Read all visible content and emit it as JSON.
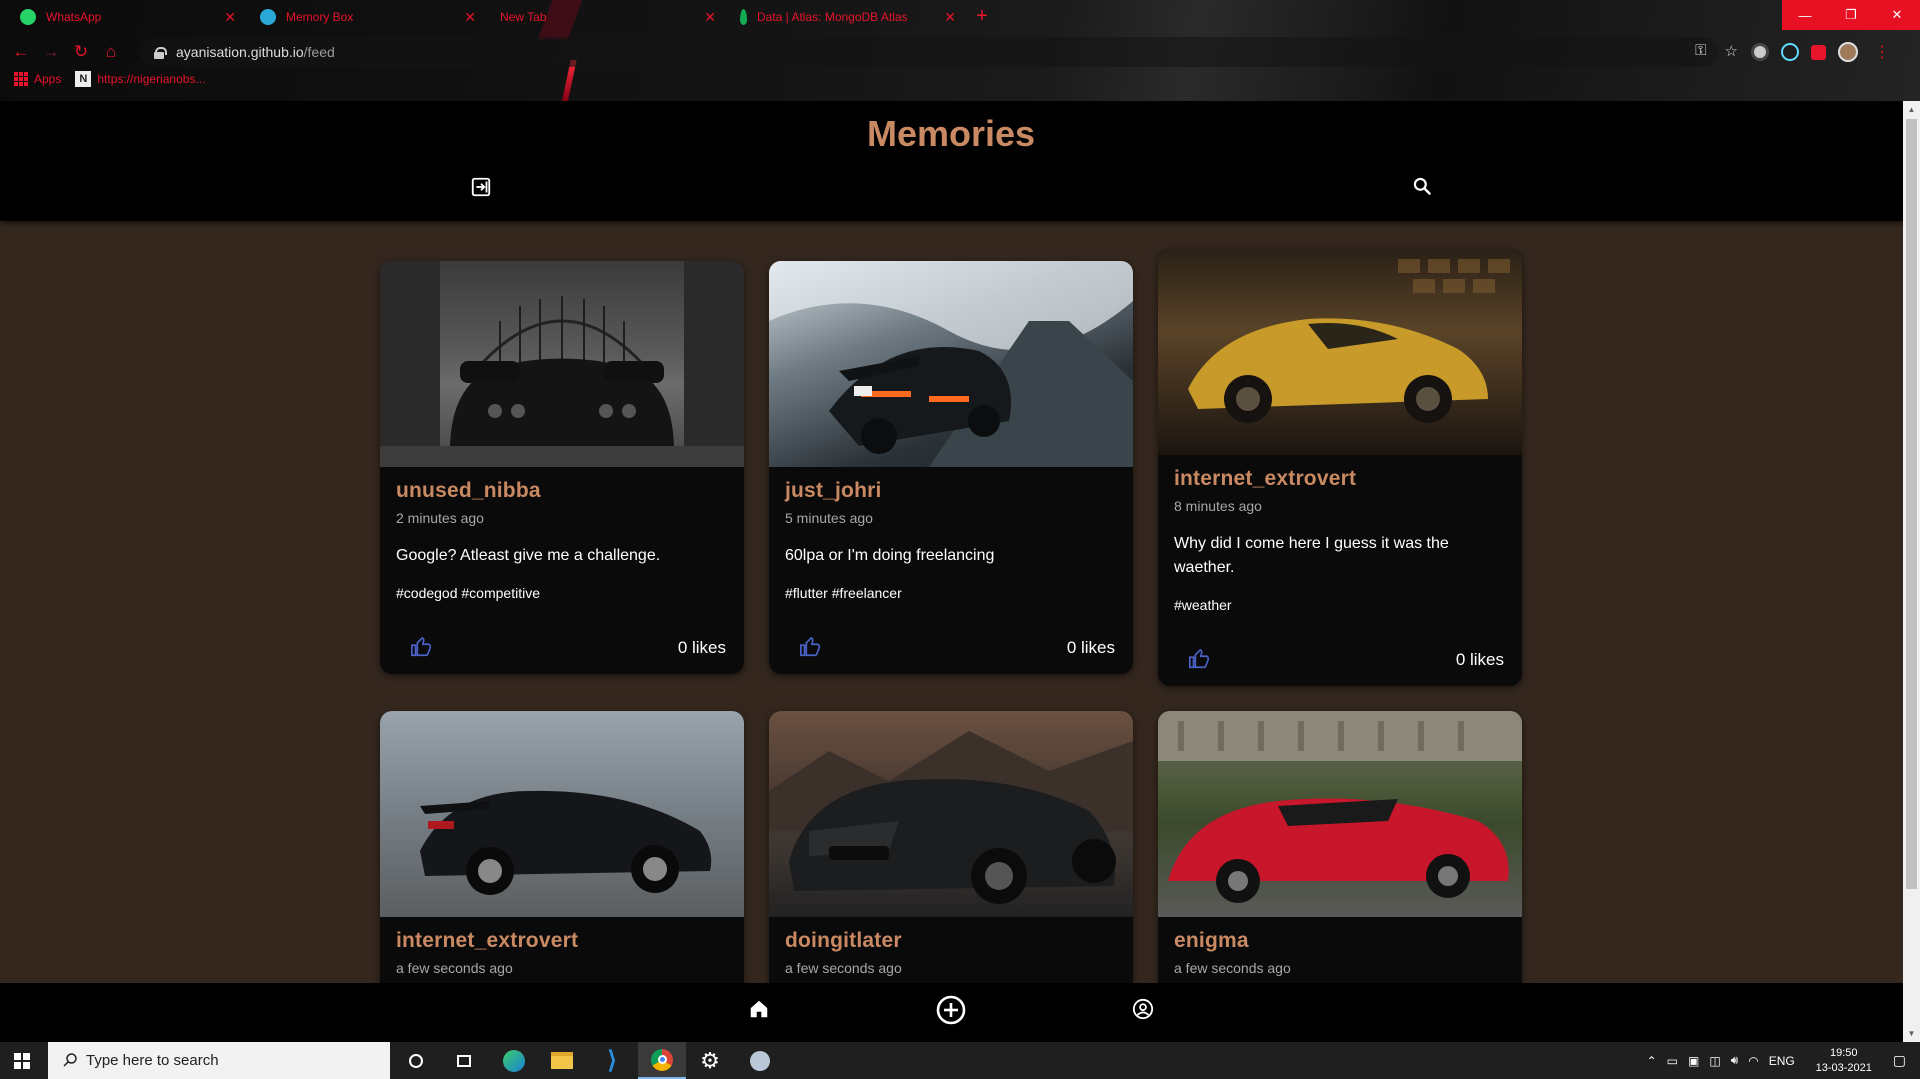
{
  "browser": {
    "tabs": [
      {
        "title": "WhatsApp",
        "icon": "whatsapp-icon",
        "color": "#25d366"
      },
      {
        "title": "Memory Box",
        "icon": "memory-box-icon",
        "color": "#2aa8d8"
      },
      {
        "title": "New Tab",
        "icon": "",
        "color": ""
      },
      {
        "title": "Data | Atlas: MongoDB Atlas",
        "icon": "mongodb-leaf-icon",
        "color": "#13aa52"
      }
    ],
    "url_host": "ayanisation.github.io",
    "url_path": "/feed",
    "bookmarks": [
      {
        "label": "Apps"
      },
      {
        "label": "https://nigerianobs..."
      }
    ]
  },
  "app": {
    "title": "Memories",
    "accent": "#c98a63",
    "background": "#34271e"
  },
  "posts": [
    {
      "author": "unused_nibba",
      "time": "2 minutes ago",
      "message": "Google? Atleast give me a challenge.",
      "tags": "#codegod #competitive",
      "likes": "0 likes",
      "image": "black-porsche-carrera-gt-rear-gate"
    },
    {
      "author": "just_johri",
      "time": "5 minutes ago",
      "message": "60lpa or I'm doing freelancing",
      "tags": "#flutter #freelancer",
      "likes": "0 likes",
      "image": "need-for-speed-snow-race"
    },
    {
      "author": "internet_extrovert",
      "time": "8 minutes ago",
      "message": "Why did I come here I guess it was the waether.",
      "tags": "#weather",
      "likes": "0 likes",
      "image": "gold-porsche-911"
    },
    {
      "author": "internet_extrovert",
      "time": "a few seconds ago",
      "message": "",
      "tags": "",
      "likes": "",
      "image": "black-porsche-carrera-gt"
    },
    {
      "author": "doingitlater",
      "time": "a few seconds ago",
      "message": "",
      "tags": "",
      "likes": "",
      "image": "black-aston-martin"
    },
    {
      "author": "enigma",
      "time": "a few seconds ago",
      "message": "",
      "tags": "",
      "likes": "",
      "image": "red-lamborghini-veneno"
    }
  ],
  "taskbar": {
    "search_placeholder": "Type here to search",
    "language": "ENG",
    "time": "19:50",
    "date": "13-03-2021"
  }
}
